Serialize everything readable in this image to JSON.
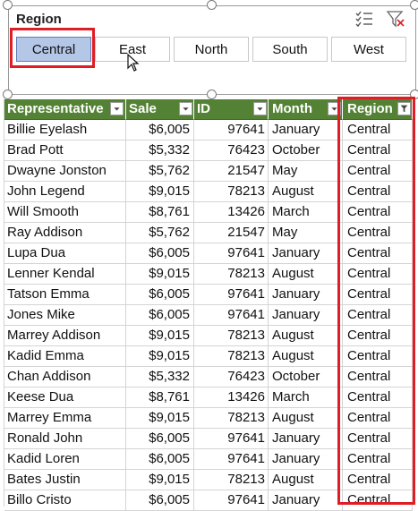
{
  "slicer": {
    "title": "Region",
    "icons": {
      "multiselect": "multi-select-icon",
      "clear": "clear-filter-icon"
    },
    "items": [
      {
        "label": "Central",
        "selected": true
      },
      {
        "label": "East",
        "selected": false
      },
      {
        "label": "North",
        "selected": false
      },
      {
        "label": "South",
        "selected": false
      },
      {
        "label": "West",
        "selected": false
      }
    ]
  },
  "table": {
    "header_color": "#548235",
    "columns": [
      "Representative",
      "Sale",
      "ID",
      "Month",
      "Region"
    ],
    "rows": [
      [
        "Billie Eyelash",
        "$6,005",
        "97641",
        "January",
        "Central"
      ],
      [
        "Brad Pott",
        "$5,332",
        "76423",
        "October",
        "Central"
      ],
      [
        "Dwayne Jonston",
        "$5,762",
        "21547",
        "May",
        "Central"
      ],
      [
        "John Legend",
        "$9,015",
        "78213",
        "August",
        "Central"
      ],
      [
        "Will Smooth",
        "$8,761",
        "13426",
        "March",
        "Central"
      ],
      [
        "Ray Addison",
        "$5,762",
        "21547",
        "May",
        "Central"
      ],
      [
        "Lupa Dua",
        "$6,005",
        "97641",
        "January",
        "Central"
      ],
      [
        "Lenner Kendal",
        "$9,015",
        "78213",
        "August",
        "Central"
      ],
      [
        "Tatson Emma",
        "$6,005",
        "97641",
        "January",
        "Central"
      ],
      [
        "Jones Mike",
        "$6,005",
        "97641",
        "January",
        "Central"
      ],
      [
        "Marrey Addison",
        "$9,015",
        "78213",
        "August",
        "Central"
      ],
      [
        "Kadid Emma",
        "$9,015",
        "78213",
        "August",
        "Central"
      ],
      [
        "Chan Addison",
        "$5,332",
        "76423",
        "October",
        "Central"
      ],
      [
        "Keese Dua",
        "$8,761",
        "13426",
        "March",
        "Central"
      ],
      [
        "Marrey Emma",
        "$9,015",
        "78213",
        "August",
        "Central"
      ],
      [
        "Ronald John",
        "$6,005",
        "97641",
        "January",
        "Central"
      ],
      [
        "Kadid Loren",
        "$6,005",
        "97641",
        "January",
        "Central"
      ],
      [
        "Bates Justin",
        "$9,015",
        "78213",
        "August",
        "Central"
      ],
      [
        "Billo Cristo",
        "$6,005",
        "97641",
        "January",
        "Central"
      ]
    ]
  },
  "highlight_color": "#e01c24"
}
